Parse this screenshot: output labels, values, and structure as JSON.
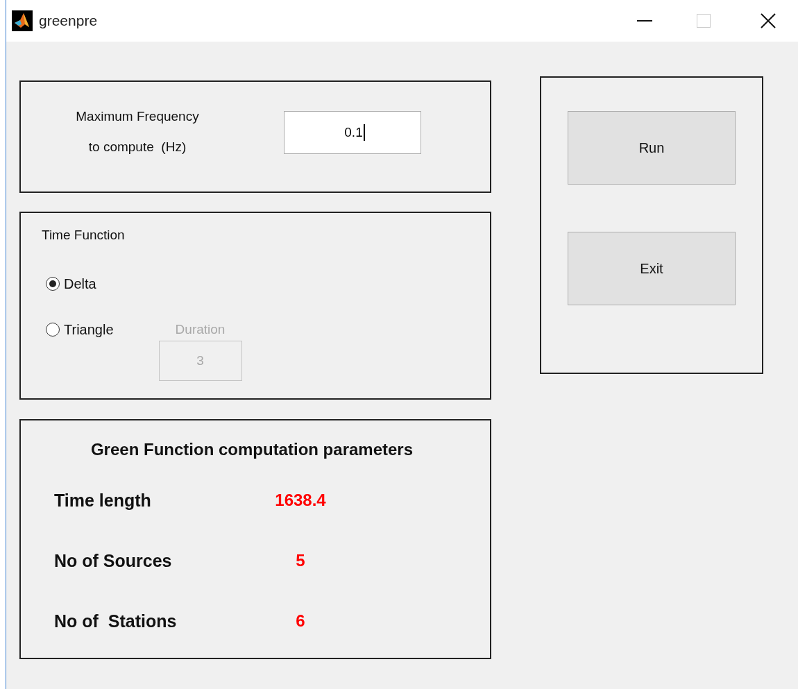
{
  "window": {
    "title": "greenpre",
    "maximize_disabled": true
  },
  "frequency_panel": {
    "label_lines": [
      "Maximum Frequency",
      "to compute  (Hz)"
    ],
    "value": "0.1",
    "focused": true
  },
  "time_function": {
    "title": "Time Function",
    "options": [
      {
        "label": "Delta",
        "selected": true
      },
      {
        "label": "Triangle",
        "selected": false
      }
    ],
    "duration": {
      "label": "Duration",
      "value": "3",
      "disabled": true
    }
  },
  "parameters": {
    "title": "Green Function computation parameters",
    "rows": [
      {
        "label": "Time length",
        "value": "1638.4"
      },
      {
        "label": "No of Sources",
        "value": "5"
      },
      {
        "label": "No of  Stations",
        "value": "6"
      }
    ]
  },
  "buttons": [
    "Run",
    "Exit"
  ]
}
